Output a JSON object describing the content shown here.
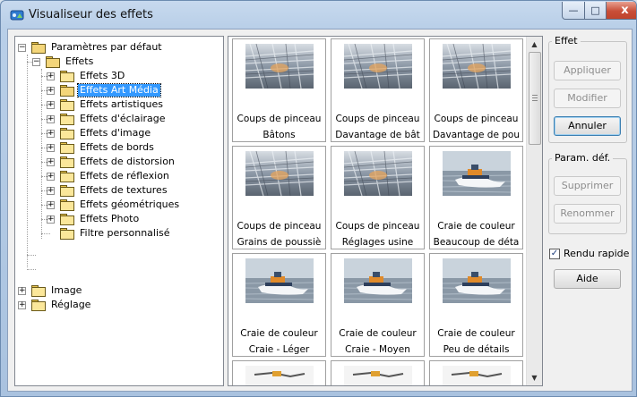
{
  "window": {
    "title": "Visualiseur des effets",
    "controls": {
      "minimize": "—",
      "maximize": "□",
      "close": "x"
    }
  },
  "tree": {
    "root": "Paramètres par défaut",
    "effects": "Effets",
    "children": [
      "Effets 3D",
      "Effets Art Média",
      "Effets artistiques",
      "Effets d'éclairage",
      "Effets d'image",
      "Effets de bords",
      "Effets de distorsion",
      "Effets de réflexion",
      "Effets de textures",
      "Effets géométriques",
      "Effets Photo",
      "Filtre personnalisé"
    ],
    "selected": "Effets Art Média",
    "image": "Image",
    "reglage": "Réglage"
  },
  "gallery": {
    "items": [
      {
        "line1": "Coups de pinceau",
        "line2": "Bâtons",
        "thumb": "brush-strokes"
      },
      {
        "line1": "Coups de pinceau",
        "line2": "Davantage de bât",
        "thumb": "brush-strokes"
      },
      {
        "line1": "Coups de pinceau",
        "line2": "Davantage de pou",
        "thumb": "brush-strokes"
      },
      {
        "line1": "Coups de pinceau",
        "line2": "Grains de poussiè",
        "thumb": "brush-strokes"
      },
      {
        "line1": "Coups de pinceau",
        "line2": "Réglages usine",
        "thumb": "brush-strokes"
      },
      {
        "line1": "Craie de couleur",
        "line2": "Beaucoup de déta",
        "thumb": "boat-photo"
      },
      {
        "line1": "Craie de couleur",
        "line2": "Craie - Léger",
        "thumb": "boat-photo"
      },
      {
        "line1": "Craie de couleur",
        "line2": "Craie - Moyen",
        "thumb": "boat-photo"
      },
      {
        "line1": "Craie de couleur",
        "line2": "Peu de détails",
        "thumb": "boat-photo"
      }
    ]
  },
  "effet_group": {
    "title": "Effet",
    "apply": "Appliquer",
    "modify": "Modifier",
    "cancel": "Annuler"
  },
  "param_group": {
    "title": "Param. déf.",
    "delete": "Supprimer",
    "rename": "Renommer"
  },
  "fast_render": {
    "label": "Rendu rapide",
    "checked": true
  },
  "help": "Aide",
  "colors": {
    "selection": "#3399ff",
    "title_bar": "#b9cfe8",
    "close_button": "#c84e38"
  }
}
